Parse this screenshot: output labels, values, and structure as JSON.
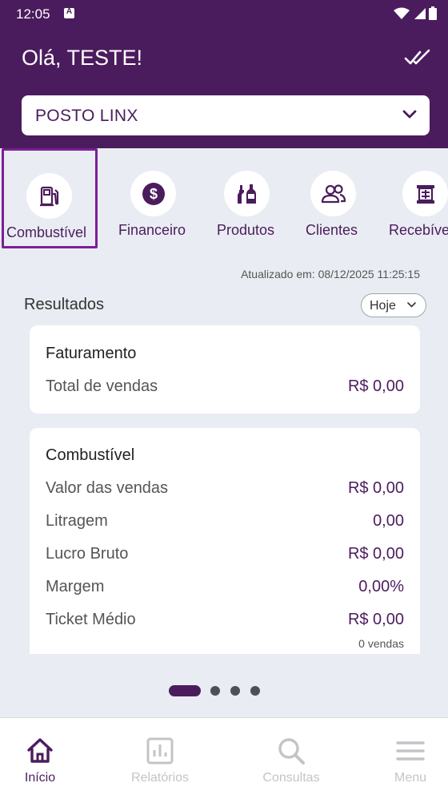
{
  "status": {
    "time": "12:05",
    "notif_icon": "a-icon"
  },
  "header": {
    "greeting": "Olá, TESTE!",
    "check_icon": "double-check-icon",
    "station_select": "POSTO LINX"
  },
  "categories": [
    {
      "label": "Combustível",
      "icon": "fuel-pump-icon",
      "active": true
    },
    {
      "label": "Financeiro",
      "icon": "dollar-icon",
      "active": false
    },
    {
      "label": "Produtos",
      "icon": "bottles-icon",
      "active": false
    },
    {
      "label": "Clientes",
      "icon": "users-icon",
      "active": false
    },
    {
      "label": "Recebíve",
      "icon": "register-icon",
      "active": false
    }
  ],
  "updated_text": "Atualizado em: 08/12/2025 11:25:15",
  "results": {
    "title": "Resultados",
    "period_filter": "Hoje"
  },
  "faturamento": {
    "title": "Faturamento",
    "rows": [
      {
        "label": "Total de vendas",
        "value": "R$ 0,00"
      }
    ]
  },
  "combustivel": {
    "title": "Combustível",
    "rows": [
      {
        "label": "Valor das vendas",
        "value": "R$ 0,00"
      },
      {
        "label": "Litragem",
        "value": "0,00"
      },
      {
        "label": "Lucro Bruto",
        "value": "R$ 0,00"
      },
      {
        "label": "Margem",
        "value": "0,00%"
      },
      {
        "label": "Ticket Médio",
        "value": "R$ 0,00"
      }
    ],
    "ticket_sub": "0 vendas"
  },
  "pager": {
    "pages": 4,
    "current": 1
  },
  "bottom_nav": [
    {
      "label": "Início",
      "icon": "home-icon",
      "active": true
    },
    {
      "label": "Relatórios",
      "icon": "reports-icon",
      "active": false
    },
    {
      "label": "Consultas",
      "icon": "search-icon",
      "active": false
    },
    {
      "label": "Menu",
      "icon": "menu-icon",
      "active": false
    }
  ],
  "colors": {
    "primary": "#4b1c5d",
    "highlight": "#7b1f95",
    "background": "#e9ecf2"
  }
}
